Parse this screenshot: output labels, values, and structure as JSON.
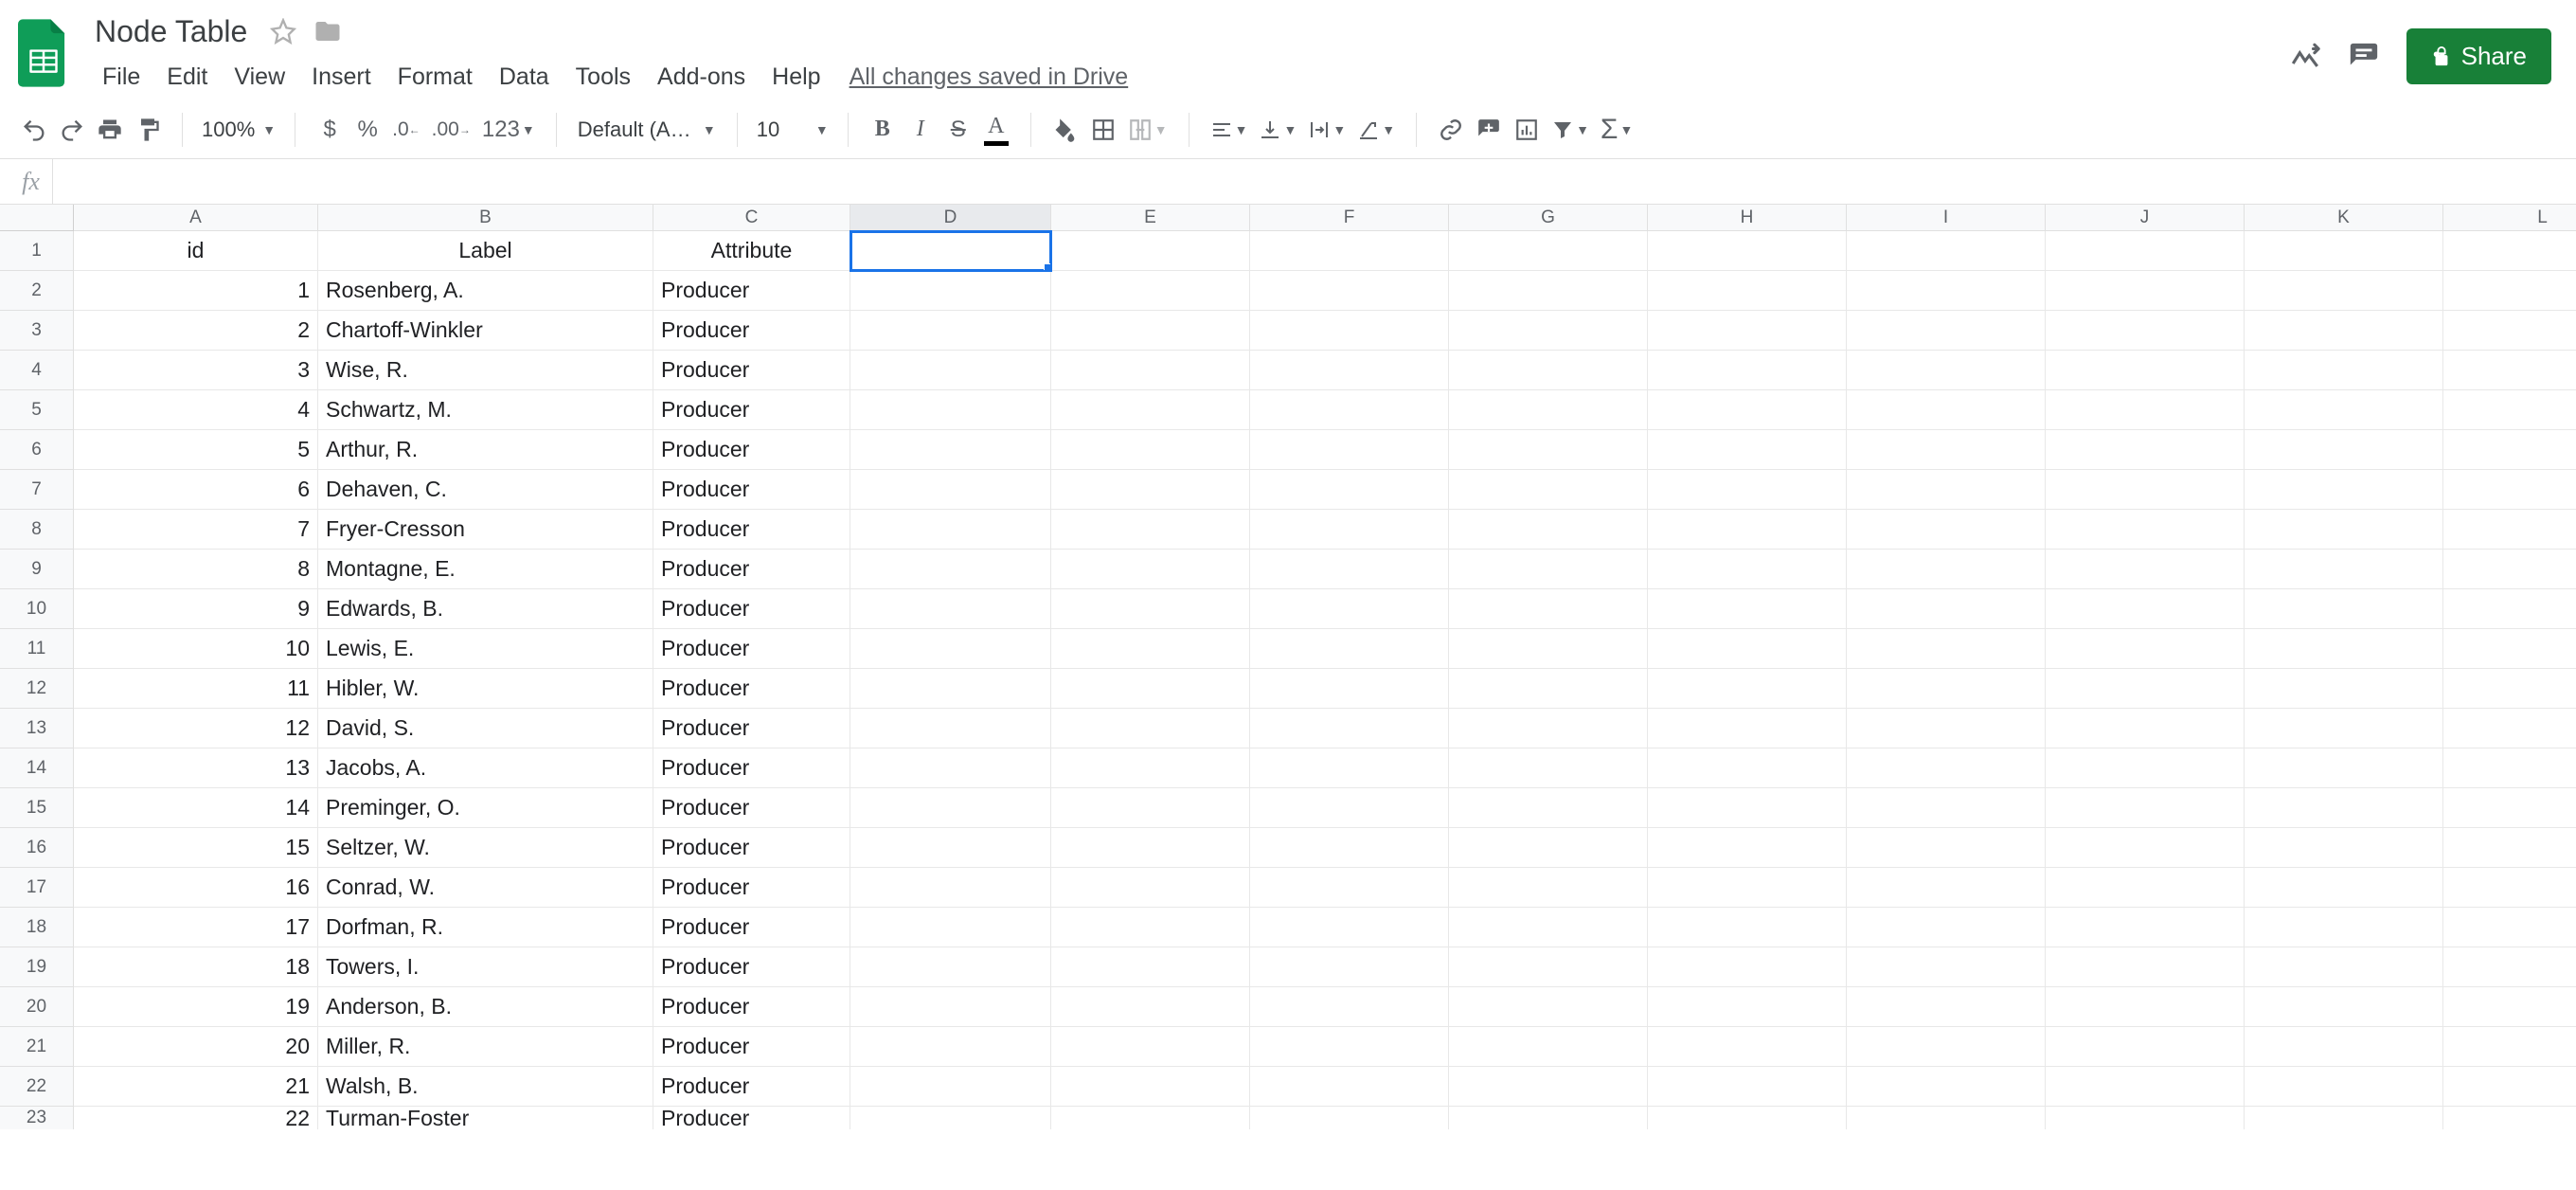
{
  "doc_title": "Node Table",
  "menus": [
    "File",
    "Edit",
    "View",
    "Insert",
    "Format",
    "Data",
    "Tools",
    "Add-ons",
    "Help"
  ],
  "save_status": "All changes saved in Drive",
  "share_label": "Share",
  "toolbar": {
    "zoom": "100%",
    "font": "Default (Ari…",
    "font_size": "10",
    "fmt123": "123"
  },
  "fx_value": "",
  "columns": [
    "A",
    "B",
    "C",
    "D",
    "E",
    "F",
    "G",
    "H",
    "I",
    "J",
    "K",
    "L"
  ],
  "active_cell": {
    "row": 1,
    "col": 4
  },
  "selected_col": 4,
  "header_row": [
    "id",
    "Label",
    "Attribute",
    "",
    "",
    "",
    "",
    "",
    "",
    "",
    "",
    ""
  ],
  "rows": [
    {
      "n": 2,
      "cells": [
        "1",
        "Rosenberg, A.",
        "Producer",
        "",
        "",
        "",
        "",
        "",
        "",
        "",
        "",
        ""
      ]
    },
    {
      "n": 3,
      "cells": [
        "2",
        "Chartoff-Winkler",
        "Producer",
        "",
        "",
        "",
        "",
        "",
        "",
        "",
        "",
        ""
      ]
    },
    {
      "n": 4,
      "cells": [
        "3",
        "Wise, R.",
        "Producer",
        "",
        "",
        "",
        "",
        "",
        "",
        "",
        "",
        ""
      ]
    },
    {
      "n": 5,
      "cells": [
        "4",
        "Schwartz, M.",
        "Producer",
        "",
        "",
        "",
        "",
        "",
        "",
        "",
        "",
        ""
      ]
    },
    {
      "n": 6,
      "cells": [
        "5",
        "Arthur, R.",
        "Producer",
        "",
        "",
        "",
        "",
        "",
        "",
        "",
        "",
        ""
      ]
    },
    {
      "n": 7,
      "cells": [
        "6",
        "Dehaven, C.",
        "Producer",
        "",
        "",
        "",
        "",
        "",
        "",
        "",
        "",
        ""
      ]
    },
    {
      "n": 8,
      "cells": [
        "7",
        "Fryer-Cresson",
        "Producer",
        "",
        "",
        "",
        "",
        "",
        "",
        "",
        "",
        ""
      ]
    },
    {
      "n": 9,
      "cells": [
        "8",
        "Montagne, E.",
        "Producer",
        "",
        "",
        "",
        "",
        "",
        "",
        "",
        "",
        ""
      ]
    },
    {
      "n": 10,
      "cells": [
        "9",
        "Edwards, B.",
        "Producer",
        "",
        "",
        "",
        "",
        "",
        "",
        "",
        "",
        ""
      ]
    },
    {
      "n": 11,
      "cells": [
        "10",
        "Lewis, E.",
        "Producer",
        "",
        "",
        "",
        "",
        "",
        "",
        "",
        "",
        ""
      ]
    },
    {
      "n": 12,
      "cells": [
        "11",
        "Hibler, W.",
        "Producer",
        "",
        "",
        "",
        "",
        "",
        "",
        "",
        "",
        ""
      ]
    },
    {
      "n": 13,
      "cells": [
        "12",
        "David, S.",
        "Producer",
        "",
        "",
        "",
        "",
        "",
        "",
        "",
        "",
        ""
      ]
    },
    {
      "n": 14,
      "cells": [
        "13",
        "Jacobs, A.",
        "Producer",
        "",
        "",
        "",
        "",
        "",
        "",
        "",
        "",
        ""
      ]
    },
    {
      "n": 15,
      "cells": [
        "14",
        "Preminger, O.",
        "Producer",
        "",
        "",
        "",
        "",
        "",
        "",
        "",
        "",
        ""
      ]
    },
    {
      "n": 16,
      "cells": [
        "15",
        "Seltzer, W.",
        "Producer",
        "",
        "",
        "",
        "",
        "",
        "",
        "",
        "",
        ""
      ]
    },
    {
      "n": 17,
      "cells": [
        "16",
        "Conrad, W.",
        "Producer",
        "",
        "",
        "",
        "",
        "",
        "",
        "",
        "",
        ""
      ]
    },
    {
      "n": 18,
      "cells": [
        "17",
        "Dorfman, R.",
        "Producer",
        "",
        "",
        "",
        "",
        "",
        "",
        "",
        "",
        ""
      ]
    },
    {
      "n": 19,
      "cells": [
        "18",
        "Towers, I.",
        "Producer",
        "",
        "",
        "",
        "",
        "",
        "",
        "",
        "",
        ""
      ]
    },
    {
      "n": 20,
      "cells": [
        "19",
        "Anderson, B.",
        "Producer",
        "",
        "",
        "",
        "",
        "",
        "",
        "",
        "",
        ""
      ]
    },
    {
      "n": 21,
      "cells": [
        "20",
        "Miller, R.",
        "Producer",
        "",
        "",
        "",
        "",
        "",
        "",
        "",
        "",
        ""
      ]
    },
    {
      "n": 22,
      "cells": [
        "21",
        "Walsh, B.",
        "Producer",
        "",
        "",
        "",
        "",
        "",
        "",
        "",
        "",
        ""
      ]
    },
    {
      "n": 23,
      "cells": [
        "22",
        "Turman-Foster",
        "Producer",
        "",
        "",
        "",
        "",
        "",
        "",
        "",
        "",
        ""
      ]
    }
  ]
}
